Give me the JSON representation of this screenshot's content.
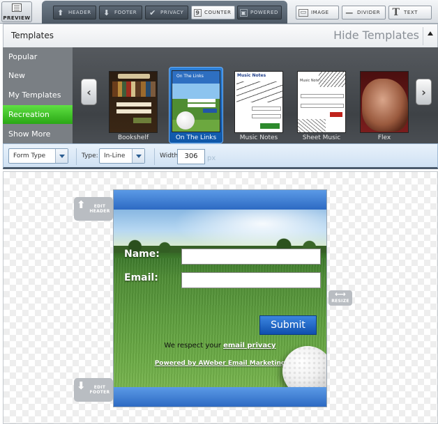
{
  "toolbar": {
    "preview_label": "PREVIEW",
    "buttons": [
      {
        "label": "HEADER",
        "icon": "arrow-up-icon"
      },
      {
        "label": "FOOTER",
        "icon": "arrow-down-icon"
      },
      {
        "label": "PRIVACY",
        "icon": "checkmark-icon"
      },
      {
        "label": "COUNTER",
        "icon": "counter-icon"
      },
      {
        "label": "POWERED",
        "icon": "powered-icon"
      },
      {
        "label": "IMAGE",
        "icon": "image-icon"
      },
      {
        "label": "DIVIDER",
        "icon": "divider-icon"
      },
      {
        "label": "TEXT",
        "icon": "text-icon"
      }
    ]
  },
  "templates": {
    "title": "Templates",
    "hide_label": "Hide Templates",
    "categories": [
      "Popular",
      "New",
      "My Templates",
      "Recreation",
      "Show More"
    ],
    "active_category": "Recreation",
    "items": [
      {
        "name": "Bookshelf"
      },
      {
        "name": "On The Links",
        "header_text": "On The Links",
        "selected": true
      },
      {
        "name": "Music Notes",
        "header_text": "Music Notes"
      },
      {
        "name": "Sheet Music",
        "header_text": "Music Notes"
      },
      {
        "name": "Flex"
      }
    ]
  },
  "options": {
    "form_type_label": "Form Type",
    "type_label": "Type:",
    "type_value": "In-Line",
    "width_label": "Width:",
    "width_value": "306",
    "width_unit": "px"
  },
  "form": {
    "name_label": "Name:",
    "email_label": "Email:",
    "submit_label": "Submit",
    "privacy_prefix": "We respect your ",
    "privacy_link": "email privacy",
    "powered_text": "Powered by AWeber Email Marketing",
    "edit_header_label": "EDIT HEADER",
    "edit_footer_label": "EDIT FOOTER",
    "resize_label": "RESIZE"
  },
  "colors": {
    "active_category": "#3cbe23",
    "form_header": "#2d6ac3",
    "submit_button": "#0f4fae"
  }
}
